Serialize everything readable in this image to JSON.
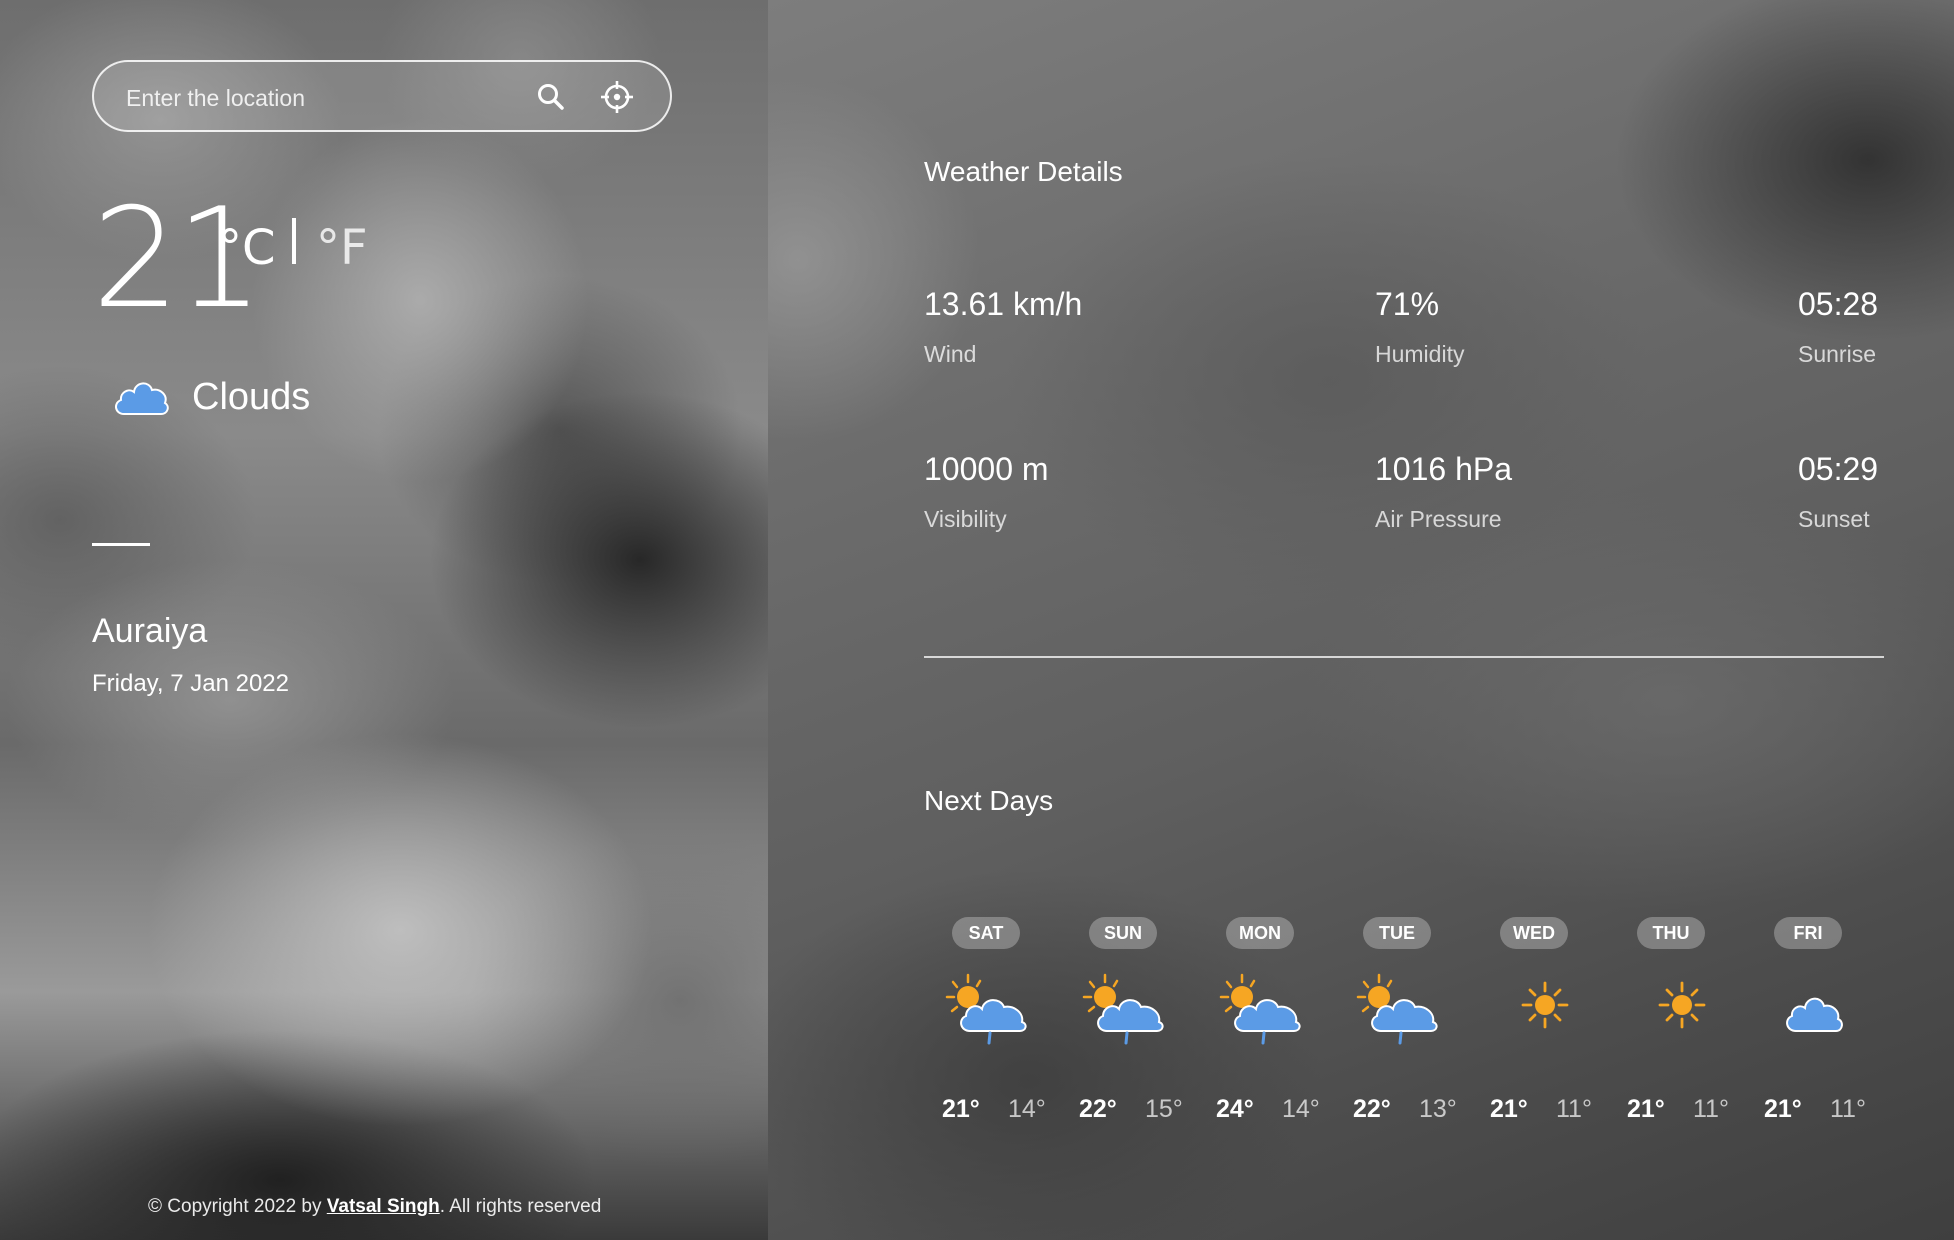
{
  "search": {
    "placeholder": "Enter the location"
  },
  "current": {
    "temperature": "21",
    "unit_c": "°C",
    "unit_f": "°F",
    "condition": "Clouds",
    "condition_icon": "cloud-icon",
    "city": "Auraiya",
    "date": "Friday, 7 Jan 2022"
  },
  "footer": {
    "prefix": "© Copyright 2022 by ",
    "author": "Vatsal Singh",
    "suffix": ". All rights reserved"
  },
  "details": {
    "title": "Weather Details",
    "items": [
      {
        "value": "13.61 km/h",
        "label": "Wind"
      },
      {
        "value": "71%",
        "label": "Humidity"
      },
      {
        "value": "05:28",
        "label": "Sunrise"
      },
      {
        "value": "10000 m",
        "label": "Visibility"
      },
      {
        "value": "1016 hPa",
        "label": "Air Pressure"
      },
      {
        "value": "05:29",
        "label": "Sunset"
      }
    ]
  },
  "forecast": {
    "title": "Next Days",
    "days": [
      {
        "day": "SAT",
        "icon": "sun-cloud-rain-icon",
        "high": "21°",
        "low": "14°"
      },
      {
        "day": "SUN",
        "icon": "sun-cloud-rain-icon",
        "high": "22°",
        "low": "15°"
      },
      {
        "day": "MON",
        "icon": "sun-cloud-rain-icon",
        "high": "24°",
        "low": "14°"
      },
      {
        "day": "TUE",
        "icon": "sun-cloud-rain-icon",
        "high": "22°",
        "low": "13°"
      },
      {
        "day": "WED",
        "icon": "sun-icon",
        "high": "21°",
        "low": "11°"
      },
      {
        "day": "THU",
        "icon": "sun-icon",
        "high": "21°",
        "low": "11°"
      },
      {
        "day": "FRI",
        "icon": "cloud-icon",
        "high": "21°",
        "low": "11°"
      }
    ]
  },
  "colors": {
    "cloud": "#5b9be6",
    "sun": "#f6a623",
    "text": "#ffffff"
  }
}
